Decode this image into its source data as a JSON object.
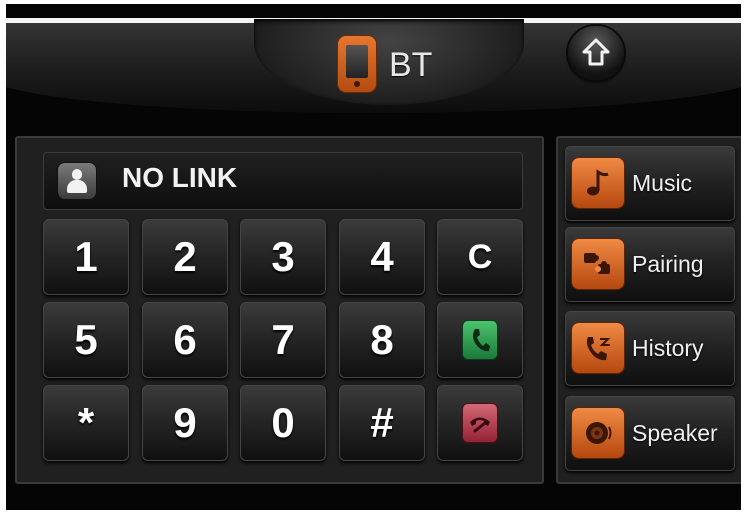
{
  "header": {
    "title": "BT",
    "app_icon": "phone-icon",
    "home_icon": "home-icon"
  },
  "display": {
    "contact_icon": "contact-icon",
    "status": "NO LINK"
  },
  "keypad": {
    "keys": [
      "1",
      "2",
      "3",
      "4",
      "C",
      "5",
      "6",
      "7",
      "8",
      "call",
      "*",
      "9",
      "0",
      "#",
      "hangup"
    ],
    "clear_label": "C"
  },
  "side_menu": {
    "items": [
      {
        "label": "Music",
        "icon": "music-note-icon"
      },
      {
        "label": "Pairing",
        "icon": "pairing-icon"
      },
      {
        "label": "History",
        "icon": "call-history-icon"
      },
      {
        "label": "Speaker",
        "icon": "speaker-icon"
      }
    ]
  },
  "colors": {
    "accent_orange": "#d8641e",
    "call_green": "#2e9c50",
    "hangup_red": "#b63a4b",
    "background": "#050505"
  }
}
